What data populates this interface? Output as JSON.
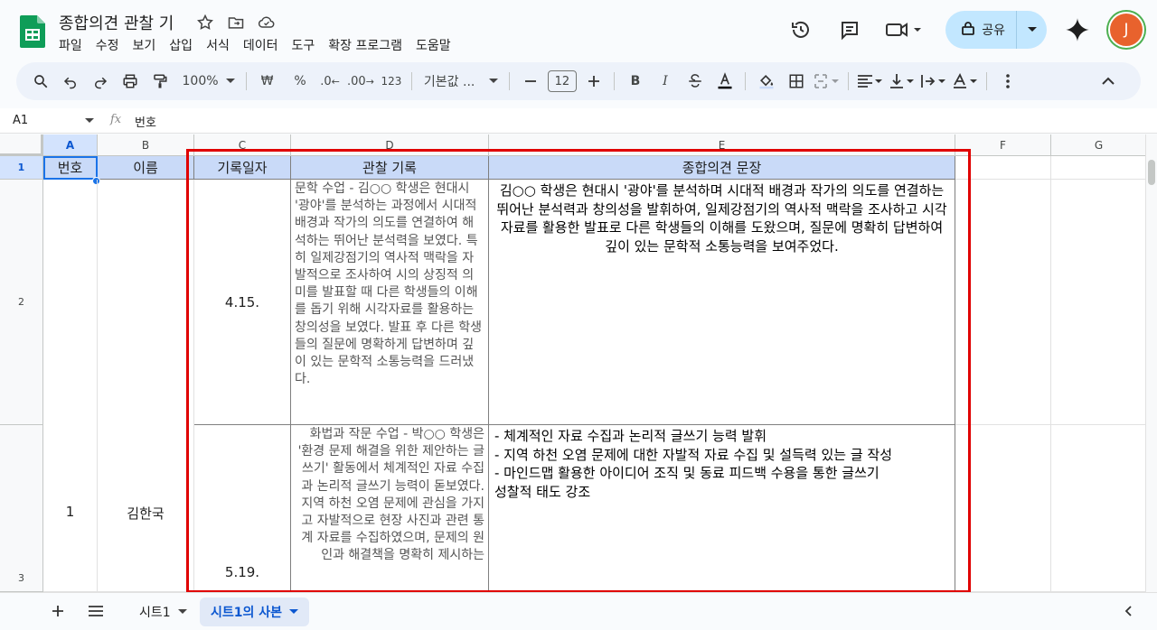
{
  "doc": {
    "title": "종합의견 관찰 기"
  },
  "menu": [
    "파일",
    "수정",
    "보기",
    "삽입",
    "서식",
    "데이터",
    "도구",
    "확장 프로그램",
    "도움말"
  ],
  "share": {
    "label": "공유"
  },
  "user": {
    "initial": "J"
  },
  "toolbar": {
    "zoom": "100%",
    "currency": "₩",
    "percent": "%",
    "dec_decrease": ".0",
    "dec_increase": ".00",
    "number_format": "123",
    "font": "기본값 ...",
    "font_size": "12",
    "bold": "B",
    "italic": "I"
  },
  "formula": {
    "cell_ref": "A1",
    "fx": "fx",
    "value": "번호"
  },
  "columns": [
    "A",
    "B",
    "C",
    "D",
    "E",
    "F",
    "G"
  ],
  "rows": [
    "1",
    "2",
    "3"
  ],
  "header_row": {
    "a": "번호",
    "b": "이름",
    "c": "기록일자",
    "d": "관찰 기록",
    "e": "종합의견 문장"
  },
  "student": {
    "number": "1",
    "name": "김한국"
  },
  "records": [
    {
      "date": "4.15.",
      "observation": "문학 수업 - 김○○ 학생은 현대시 '광야'를 분석하는 과정에서 시대적 배경과 작가의 의도를 연결하여 해석하는 뛰어난 분석력을 보였다. 특히 일제강점기의 역사적 맥락을 자발적으로 조사하여 시의 상징적 의미를 발표할 때 다른 학생들의 이해를 돕기 위해 시각자료를 활용하는 창의성을 보였다. 발표 후 다른 학생들의 질문에 명확하게 답변하며 깊이 있는 문학적 소통능력을 드러냈다.",
      "summary": "김○○ 학생은 현대시 '광야'를 분석하며 시대적 배경과 작가의 의도를 연결하는 뛰어난 분석력과 창의성을 발휘하여, 일제강점기의 역사적 맥락을 조사하고 시각자료를 활용한 발표로 다른 학생들의 이해를 도왔으며, 질문에 명확히 답변하여 깊이 있는 문학적 소통능력을 보여주었다."
    },
    {
      "date": "5.19.",
      "observation": "화법과 작문 수업 - 박○○ 학생은 '환경 문제 해결을 위한 제안하는 글쓰기' 활동에서 체계적인 자료 수집과 논리적 글쓰기 능력이 돋보였다. 지역 하천 오염 문제에 관심을 가지고 자발적으로 현장 사진과 관련 통계 자료를 수집하였으며, 문제의 원인과 해결책을 명확히 제시하는",
      "summary_lines": [
        "- 체계적인 자료 수집과 논리적 글쓰기 능력 발휘",
        "- 지역 하천 오염 문제에 대한 자발적 자료 수집 및 설득력 있는 글 작성",
        "- 마인드맵 활용한 아이디어 조직 및 동료 피드백 수용을 통한 글쓰기",
        "성찰적 태도 강조"
      ]
    }
  ],
  "sheets": [
    {
      "label": "시트1",
      "active": false
    },
    {
      "label": "시트1의 사본",
      "active": true
    }
  ],
  "colors": {
    "header_fill": "#c9daf8",
    "highlight": "#e00000",
    "accent": "#0b57d0"
  }
}
